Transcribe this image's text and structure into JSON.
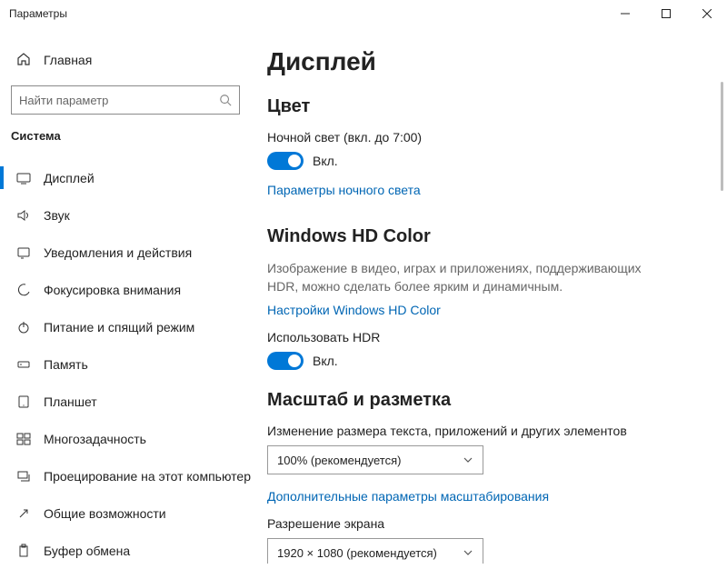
{
  "window": {
    "title": "Параметры"
  },
  "sidebar": {
    "home": "Главная",
    "search_placeholder": "Найти параметр",
    "section": "Система",
    "items": [
      {
        "label": "Дисплей",
        "icon": "display"
      },
      {
        "label": "Звук",
        "icon": "sound"
      },
      {
        "label": "Уведомления и действия",
        "icon": "notifications"
      },
      {
        "label": "Фокусировка внимания",
        "icon": "focus"
      },
      {
        "label": "Питание и спящий режим",
        "icon": "power"
      },
      {
        "label": "Память",
        "icon": "storage"
      },
      {
        "label": "Планшет",
        "icon": "tablet"
      },
      {
        "label": "Многозадачность",
        "icon": "multitask"
      },
      {
        "label": "Проецирование на этот компьютер",
        "icon": "project"
      },
      {
        "label": "Общие возможности",
        "icon": "shared"
      },
      {
        "label": "Буфер обмена",
        "icon": "clipboard"
      }
    ]
  },
  "main": {
    "title": "Дисплей",
    "color": {
      "heading": "Цвет",
      "night_light_label": "Ночной свет (вкл. до 7:00)",
      "toggle_state": "Вкл.",
      "night_light_link": "Параметры ночного света"
    },
    "hdcolor": {
      "heading": "Windows HD Color",
      "desc": "Изображение в видео, играх и приложениях, поддерживающих HDR, можно сделать более ярким и динамичным.",
      "link": "Настройки Windows HD Color",
      "use_hdr_label": "Использовать HDR",
      "toggle_state": "Вкл."
    },
    "scale": {
      "heading": "Масштаб и разметка",
      "scale_label": "Изменение размера текста, приложений и других элементов",
      "scale_value": "100% (рекомендуется)",
      "advanced_link": "Дополнительные параметры масштабирования",
      "resolution_label": "Разрешение экрана",
      "resolution_value": "1920 × 1080 (рекомендуется)"
    }
  }
}
